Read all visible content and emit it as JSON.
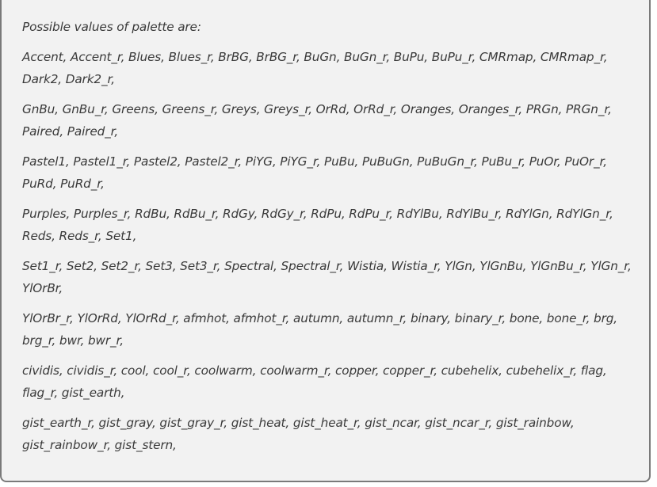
{
  "output": {
    "intro": "Possible values of palette are:",
    "lines": [
      "Accent, Accent_r, Blues, Blues_r, BrBG, BrBG_r, BuGn, BuGn_r, BuPu, BuPu_r, CMRmap, CMRmap_r, Dark2, Dark2_r,",
      "GnBu, GnBu_r, Greens, Greens_r, Greys, Greys_r, OrRd, OrRd_r, Oranges, Oranges_r, PRGn, PRGn_r, Paired, Paired_r,",
      "Pastel1, Pastel1_r, Pastel2, Pastel2_r, PiYG, PiYG_r, PuBu, PuBuGn, PuBuGn_r, PuBu_r, PuOr, PuOr_r, PuRd, PuRd_r,",
      "Purples, Purples_r, RdBu, RdBu_r, RdGy, RdGy_r, RdPu, RdPu_r, RdYlBu, RdYlBu_r, RdYlGn, RdYlGn_r, Reds, Reds_r, Set1,",
      "Set1_r, Set2, Set2_r, Set3, Set3_r, Spectral, Spectral_r, Wistia, Wistia_r, YlGn, YlGnBu, YlGnBu_r, YlGn_r, YlOrBr,",
      "YlOrBr_r, YlOrRd, YlOrRd_r, afmhot, afmhot_r, autumn, autumn_r, binary, binary_r, bone, bone_r, brg, brg_r, bwr, bwr_r,",
      "cividis, cividis_r, cool, cool_r, coolwarm, coolwarm_r, copper, copper_r, cubehelix, cubehelix_r, flag, flag_r, gist_earth,",
      "gist_earth_r, gist_gray, gist_gray_r, gist_heat, gist_heat_r, gist_ncar, gist_ncar_r, gist_rainbow, gist_rainbow_r, gist_stern,"
    ]
  },
  "colors": {
    "panel_background": "#f2f2f2",
    "panel_border": "#7a7a7a",
    "text": "#3a3a3a"
  }
}
